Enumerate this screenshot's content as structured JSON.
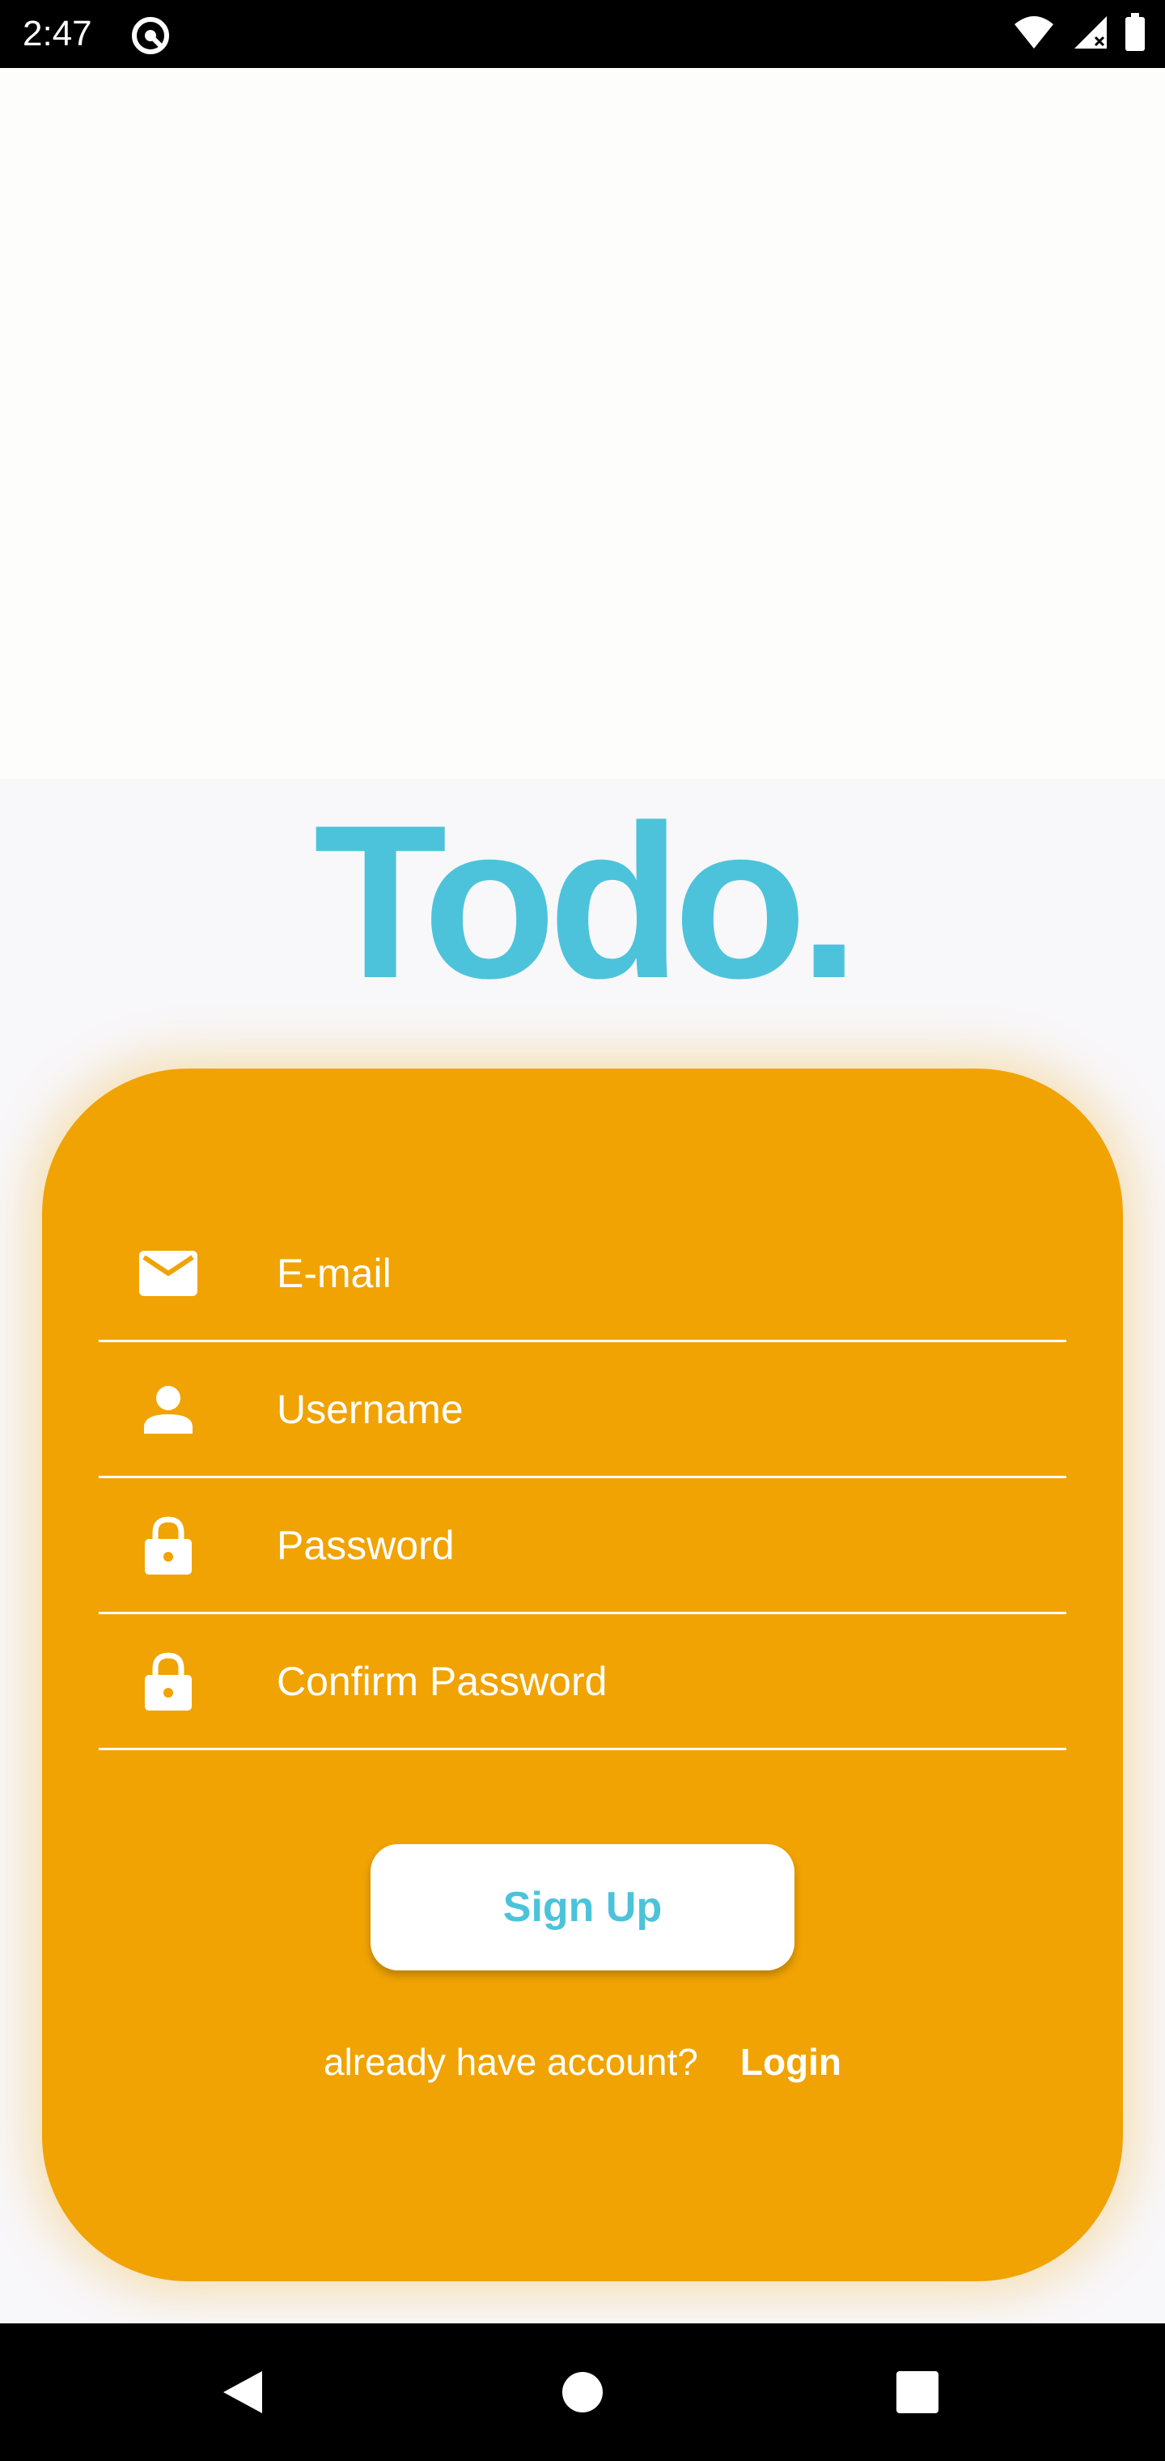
{
  "status_bar": {
    "time": "2:47"
  },
  "icons": {
    "status_app": "app-notification-icon",
    "wifi": "wifi-icon",
    "signal": "cell-signal-icon",
    "battery": "battery-icon",
    "email": "mail-icon",
    "user": "person-icon",
    "password": "lock-icon",
    "confirm_password": "lock-icon",
    "back": "back-icon",
    "home": "home-icon",
    "recents": "recents-icon"
  },
  "brand": {
    "title": "Todo."
  },
  "form": {
    "fields": [
      {
        "label": "E-mail"
      },
      {
        "label": "Username"
      },
      {
        "label": "Password"
      },
      {
        "label": "Confirm Password"
      }
    ],
    "submit_label": "Sign Up",
    "login_prompt": "already have account?",
    "login_link": "Login"
  },
  "colors": {
    "accent": "#4cc3da",
    "card": "#f0a303",
    "background": "#f8f7f9",
    "bars": "#000000"
  }
}
